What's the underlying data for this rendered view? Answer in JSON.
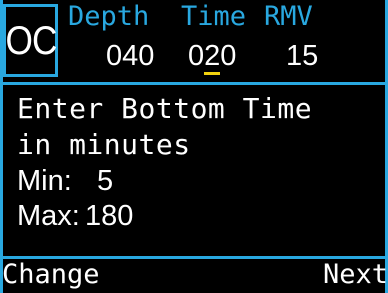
{
  "mode": "OC",
  "header": {
    "depth_label": "Depth",
    "time_label": "Time",
    "rmv_label": "RMV",
    "depth_value": "040",
    "time_value_prefix": "0",
    "time_value_cursor": "2",
    "time_value_suffix": "0",
    "rmv_value": "15"
  },
  "message": {
    "line1": "Enter Bottom Time",
    "line2": "in minutes"
  },
  "limits": {
    "min_label": "Min:",
    "min_value": "5",
    "max_label": "Max:",
    "max_value": "180"
  },
  "softkeys": {
    "left": "Change",
    "right": "Next"
  },
  "colors": {
    "accent": "#29a8e0",
    "cursor": "#f2d20f",
    "text": "#ffffff",
    "background": "#000000"
  }
}
